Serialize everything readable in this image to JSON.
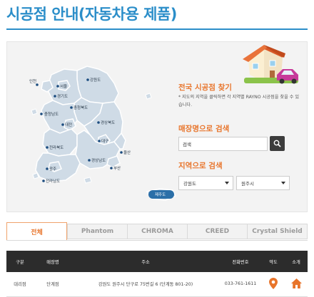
{
  "page": {
    "title": "시공점 안내(자동차용 제품)"
  },
  "map": {
    "regions": [
      "인천",
      "서울",
      "경기도",
      "강원도",
      "충청북도",
      "충청남도",
      "대전",
      "경상북도",
      "대구",
      "전라북도",
      "울산",
      "경상남도",
      "부산",
      "광주",
      "전라남도",
      "제주도"
    ]
  },
  "sidebar": {
    "national_title": "전국 시공점 찾기",
    "national_desc": "* 지도의 지역을 클릭하면 각 지역별 RAYNO 시공점을 찾을 수 있습니다.",
    "store_search_label": "매장명으로 검색",
    "store_search_value": "검색",
    "region_search_label": "지역으로 검색",
    "province_selected": "강원도",
    "city_selected": "원주시"
  },
  "tabs": [
    "전체",
    "Phantom",
    "CHROMA",
    "CREED",
    "Crystal Shield"
  ],
  "table": {
    "headers": [
      "구분",
      "매장명",
      "주소",
      "전화번호",
      "약도",
      "소개"
    ],
    "rows": [
      [
        "대리점",
        "단계점",
        "강원도 원주시 단구로 75번길 6 (단계동 801-20)",
        "033-761-1611"
      ]
    ]
  },
  "colors": {
    "title": "#2b8ec9",
    "accent": "#e8742a",
    "map_fill": "#cfdbe6",
    "pin": "#1c4d80",
    "table_header": "#2c2c2c"
  },
  "icons": {
    "search": "magnifier-icon",
    "map": "map-pin-icon",
    "intro": "home-icon"
  }
}
